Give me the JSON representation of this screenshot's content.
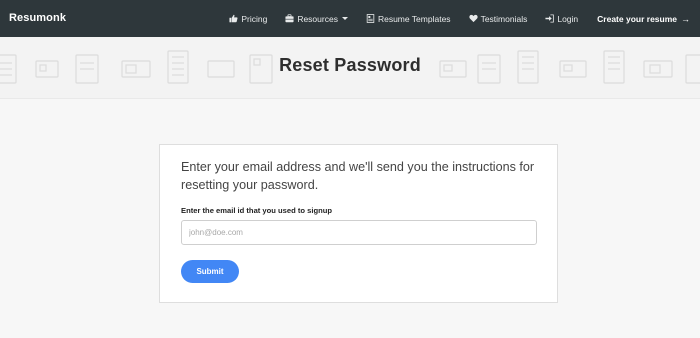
{
  "brand": "Resumonk",
  "nav": {
    "pricing": "Pricing",
    "resources": "Resources",
    "templates": "Resume Templates",
    "testimonials": "Testimonials",
    "login": "Login",
    "cta": "Create your resume",
    "cta_arrow": "→"
  },
  "page": {
    "title": "Reset Password"
  },
  "form": {
    "intro": "Enter your email address and we'll send you the instructions for resetting your password.",
    "email_label": "Enter the email id that you used to signup",
    "email_placeholder": "john@doe.com",
    "email_value": "",
    "submit_label": "Submit"
  },
  "colors": {
    "navbar_bg": "#2e373b",
    "accent_button": "#4287f5",
    "page_bg": "#f7f7f7"
  },
  "icons": {
    "pricing": "thumbs-up-icon",
    "resources": "briefcase-icon",
    "templates": "document-icon",
    "testimonials": "heart-icon",
    "login": "sign-in-icon",
    "resources_dropdown": "caret-down-icon",
    "cta_arrow": "arrow-right-icon"
  }
}
